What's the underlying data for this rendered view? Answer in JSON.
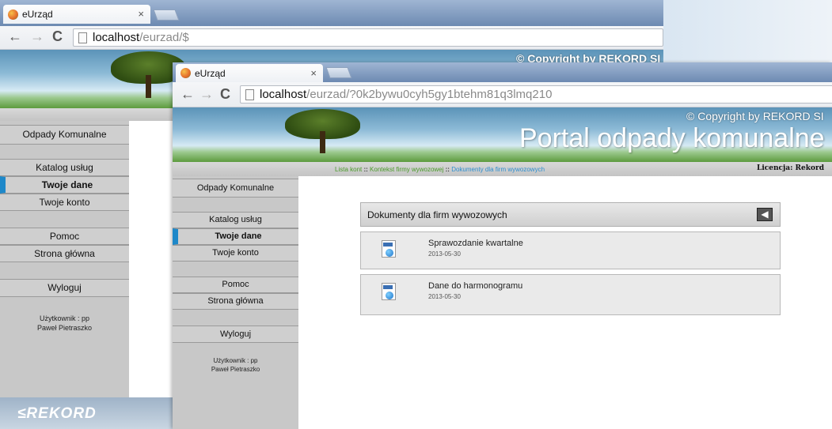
{
  "window_back": {
    "tab_title": "eUrząd",
    "url_host": "localhost",
    "url_path": "/eurzad/$",
    "copyright": "© Copyright by REKORD SI",
    "menu": [
      "Odpady Komunalne",
      "Katalog usług",
      "Twoje dane",
      "Twoje konto",
      "Pomoc",
      "Strona główna",
      "Wyloguj"
    ],
    "user_line1": "Użytkownik : pp",
    "user_line2": "Paweł Pietraszko",
    "logo": "≤REKORD"
  },
  "window_front": {
    "tab_title": "eUrząd",
    "url_host": "localhost",
    "url_path": "/eurzad/?0k2bywu0cyh5gy1btehm81q3lmq210",
    "copyright": "© Copyright by REKORD SI",
    "portal_title": "Portal odpady komunalne",
    "breadcrumb": {
      "item1": "Lista kont",
      "sep1": "::",
      "item2": "Kontekst firmy wywozowej",
      "sep2": "::",
      "item3": "Dokumenty dla firm wywozowych"
    },
    "license": "Licencja: Rekord",
    "menu": [
      "Odpady Komunalne",
      "Katalog usług",
      "Twoje dane",
      "Twoje konto",
      "Pomoc",
      "Strona główna",
      "Wyloguj"
    ],
    "user_line1": "Użytkownik : pp",
    "user_line2": "Paweł Pietraszko",
    "panel_title": "Dokumenty dla firm wywozowych",
    "documents": [
      {
        "title": "Sprawozdanie kwartalne",
        "date": "2013-05-30"
      },
      {
        "title": "Dane do harmonogramu",
        "date": "2013-05-30"
      }
    ]
  },
  "colors": {
    "accent": "#1e88c9",
    "breadcrumb_link": "#4a9a2a",
    "breadcrumb_current": "#2f8fcf"
  }
}
